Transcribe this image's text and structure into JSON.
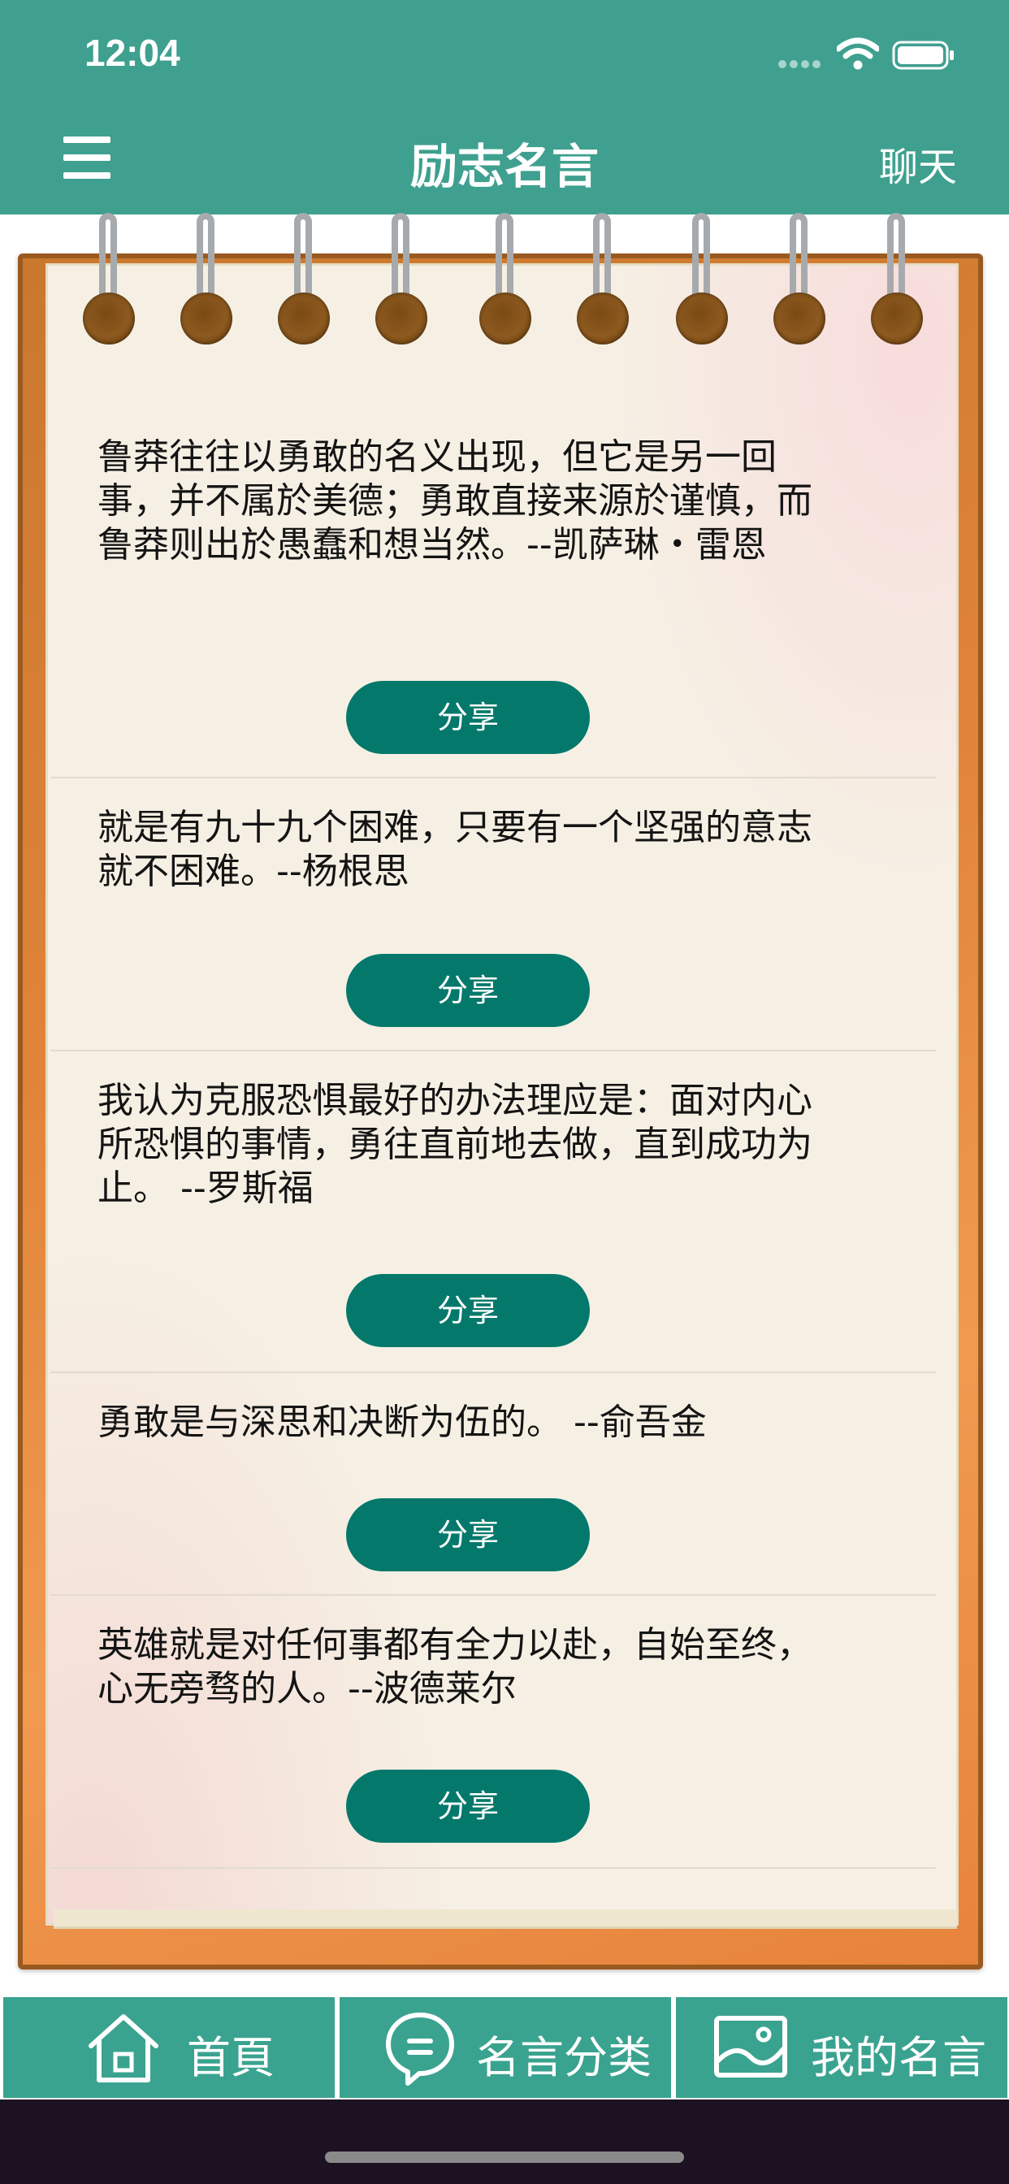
{
  "status_bar": {
    "time": "12:04"
  },
  "header": {
    "title": "励志名言",
    "chat_label": "聊天",
    "background": "#3fa08f"
  },
  "quotes": [
    {
      "text": "鲁莽往往以勇敢的名义出现，但它是另一回事，并不属於美德；勇敢直接来源於谨慎，而鲁莽则出於愚蠢和想当然。--凯萨琳・雷恩",
      "share_label": "分享"
    },
    {
      "text": "就是有九十九个困难，只要有一个坚强的意志就不困难。--杨根思",
      "share_label": "分享"
    },
    {
      "text": "我认为克服恐惧最好的办法理应是：面对内心所恐惧的事情，勇往直前地去做，直到成功为止。 --罗斯福",
      "share_label": "分享"
    },
    {
      "text": "勇敢是与深思和决断为伍的。 --俞吾金",
      "share_label": "分享"
    },
    {
      "text": "英雄就是对任何事都有全力以赴，自始至终，心无旁骛的人。--波德莱尔",
      "share_label": "分享"
    }
  ],
  "tabs": [
    {
      "label": "首頁",
      "icon": "home-icon"
    },
    {
      "label": "名言分类",
      "icon": "speech-bubble-icon"
    },
    {
      "label": "我的名言",
      "icon": "picture-frame-icon"
    }
  ],
  "colors": {
    "accent": "#3fa08f",
    "button": "#04796b",
    "paper": "#f6f0e4"
  }
}
